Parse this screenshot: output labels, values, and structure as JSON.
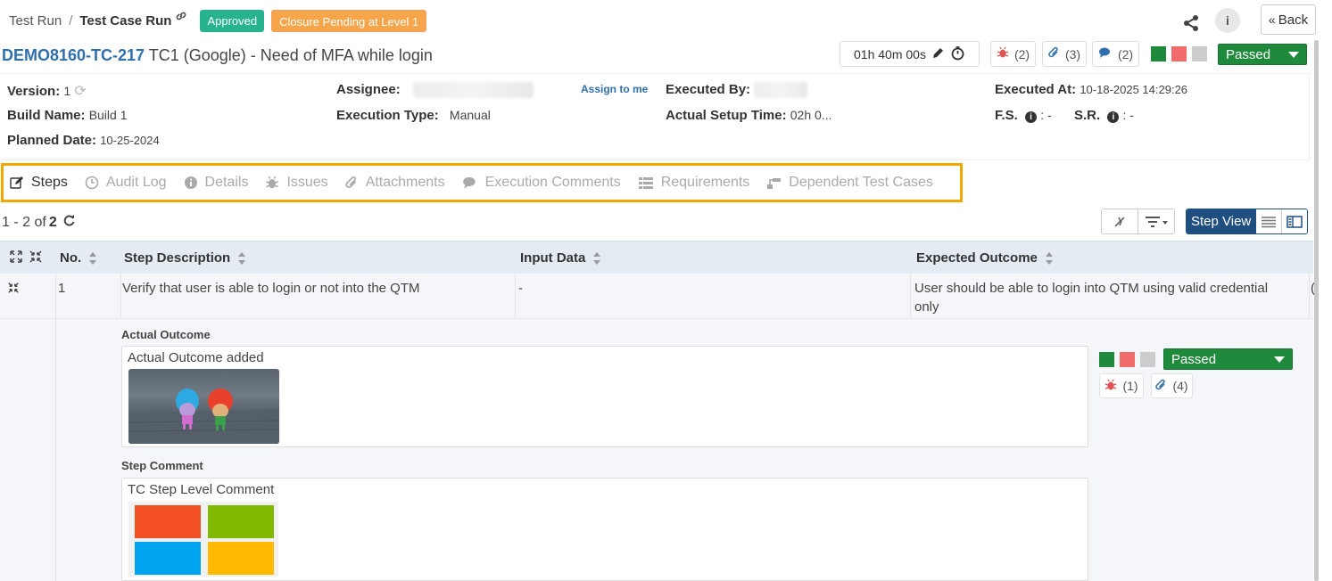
{
  "breadcrumb": {
    "parent": "Test Run",
    "separator": "/",
    "current": "Test Case Run"
  },
  "badges": {
    "approved": "Approved",
    "closure": "Closure Pending at Level 1"
  },
  "header": {
    "back_label": "Back",
    "info_label": "i"
  },
  "testcase": {
    "key": "DEMO8160-TC-217",
    "name": "TC1 (Google) - Need of MFA while login"
  },
  "toolbar": {
    "timer": "01h 40m 00s",
    "issues_count": "(2)",
    "attachments_count": "(3)",
    "comments_count": "(2)",
    "status": "Passed",
    "status_colors": {
      "pass": "#1f8a3b",
      "fail": "#f26b6b",
      "skip": "#cccccc"
    }
  },
  "meta": {
    "version_label": "Version:",
    "version_value": "1",
    "build_label": "Build Name:",
    "build_value": "Build 1",
    "planned_label": "Planned Date:",
    "planned_value": "10-25-2024",
    "assignee_label": "Assignee:",
    "assign_to_me": "Assign to me",
    "exec_type_label": "Execution Type:",
    "exec_type_value": "Manual",
    "executed_by_label": "Executed By:",
    "setup_label": "Actual Setup Time:",
    "setup_value": "02h 0...",
    "executed_at_label": "Executed At:",
    "executed_at_value": "10-18-2025 14:29:26",
    "fs_label": "F.S.",
    "fs_value": ": -",
    "sr_label": "S.R.",
    "sr_value": ": -"
  },
  "tabs": [
    {
      "label": "Steps",
      "icon": "edit-icon",
      "active": true
    },
    {
      "label": "Audit Log",
      "icon": "clock-icon"
    },
    {
      "label": "Details",
      "icon": "info-icon"
    },
    {
      "label": "Issues",
      "icon": "bug-icon"
    },
    {
      "label": "Attachments",
      "icon": "paperclip-icon"
    },
    {
      "label": "Execution Comments",
      "icon": "comments-icon"
    },
    {
      "label": "Requirements",
      "icon": "list-icon"
    },
    {
      "label": "Dependent Test Cases",
      "icon": "dependency-icon"
    }
  ],
  "pager": {
    "range": "1 - 2 of",
    "total": "2"
  },
  "stepview": {
    "label": "Step View"
  },
  "table": {
    "columns": [
      "No.",
      "Step Description",
      "Input Data",
      "Expected Outcome"
    ],
    "rows": [
      {
        "no": "1",
        "description": "Verify that user is able to login or not into the QTM",
        "input": "-",
        "expected_line1": "User should be able to login into QTM using valid credential",
        "expected_line2": "only",
        "overflow": "("
      }
    ]
  },
  "step_detail": {
    "actual_label": "Actual Outcome",
    "actual_text": "Actual Outcome added",
    "comment_label": "Step Comment",
    "comment_text": "TC Step Level Comment",
    "status": "Passed",
    "issues_count": "(1)",
    "attachments_count": "(4)"
  }
}
